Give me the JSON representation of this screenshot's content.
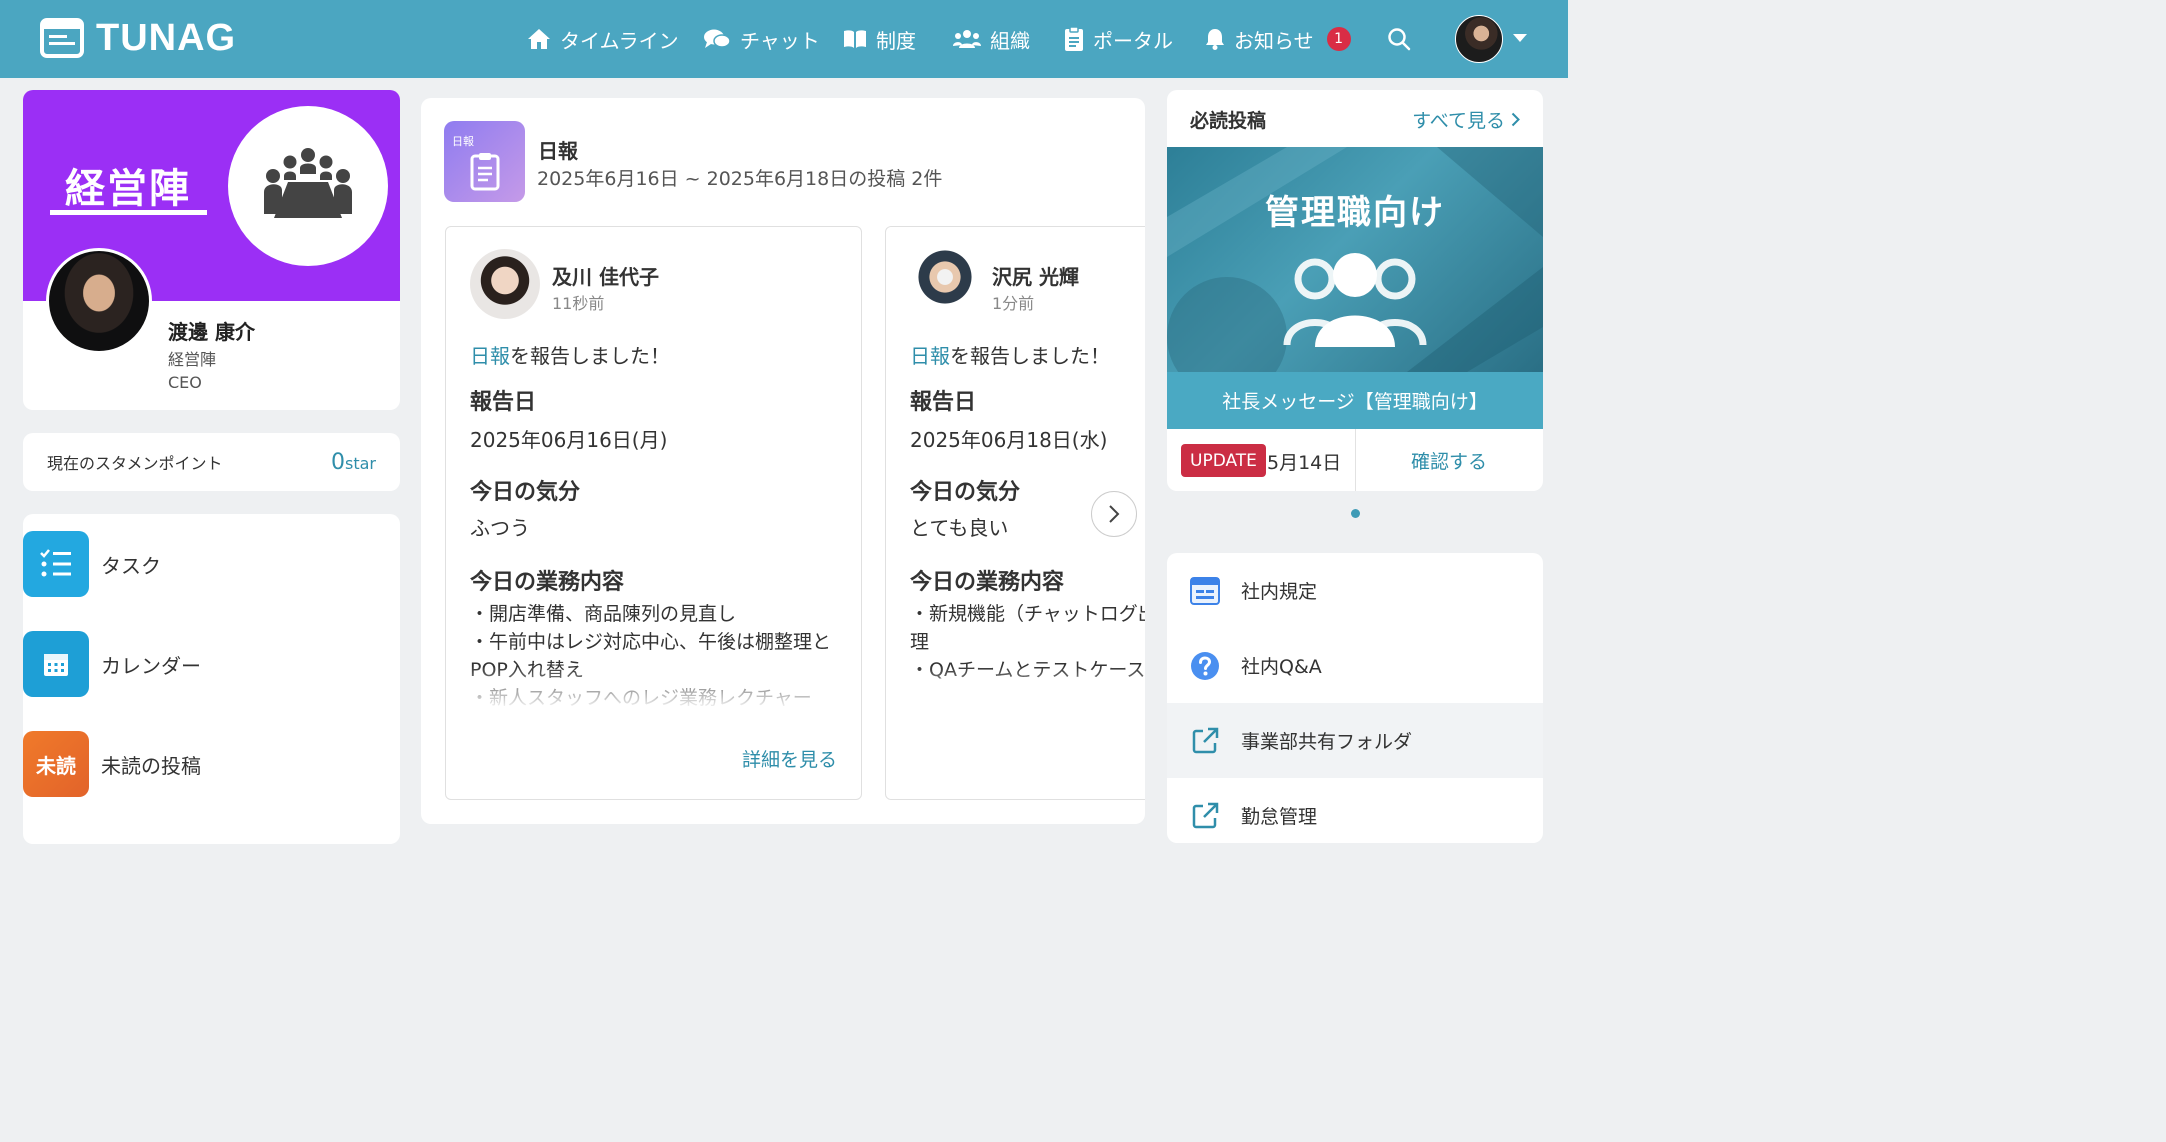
{
  "header": {
    "brand": "TUNAG",
    "nav": [
      {
        "icon": "home-icon",
        "label": "タイムライン"
      },
      {
        "icon": "chat-icon",
        "label": "チャット"
      },
      {
        "icon": "book-icon",
        "label": "制度"
      },
      {
        "icon": "people-icon",
        "label": "組織"
      },
      {
        "icon": "clipboard-icon",
        "label": "ポータル"
      },
      {
        "icon": "bell-icon",
        "label": "お知らせ"
      }
    ],
    "notification_count": "1",
    "colors": {
      "bar": "#4ba6c1",
      "badge": "#d92d45"
    }
  },
  "profile": {
    "team_name": "経営陣",
    "user_name": "渡邊 康介",
    "department": "経営陣",
    "role": "CEO",
    "banner_color": "#9b2ff5"
  },
  "stamen": {
    "label": "現在のスタメンポイント",
    "value": "0",
    "unit": "star"
  },
  "shortcuts": [
    {
      "label": "タスク",
      "icon": "task-list-icon"
    },
    {
      "label": "カレンダー",
      "icon": "calendar-icon"
    },
    {
      "label": "未読の投稿",
      "icon_text": "未読"
    }
  ],
  "nippo": {
    "title": "日報",
    "subtitle": "2025年6月16日 ~ 2025年6月18日の投稿 2件",
    "icon_text": "日報",
    "posts": [
      {
        "author": "及川 佳代子",
        "time": "11秒前",
        "link_word": "日報",
        "action": "を報告しました！",
        "h_date": "報告日",
        "date": "2025年06月16日(月)",
        "h_mood": "今日の気分",
        "mood": "ふつう",
        "h_work": "今日の業務内容",
        "work": "・開店準備、商品陳列の見直し\n・午前中はレジ対応中心、午後は棚整理とPOP入れ替え\n・新人スタッフへのレジ業務レクチャー",
        "detail_link": "詳細を見る"
      },
      {
        "author": "沢尻 光輝",
        "time": "1分前",
        "link_word": "日報",
        "action": "を報告しました！",
        "h_date": "報告日",
        "date": "2025年06月18日(水)",
        "h_mood": "今日の気分",
        "mood": "とても良い",
        "h_work": "今日の業務内容",
        "work": "・新規機能（チャットログ出力）の仕様整理\n・QAチームとテストケースのすり合わせ"
      }
    ]
  },
  "must_read": {
    "title": "必読投稿",
    "see_all": "すべて見る",
    "image_title": "管理職向け",
    "caption": "社長メッセージ【管理職向け】",
    "badge": "UPDATE",
    "date": "5月14日",
    "confirm": "確認する"
  },
  "links": [
    {
      "label": "社内規定",
      "icon": "document-icon"
    },
    {
      "label": "社内Q&A",
      "icon": "question-icon"
    },
    {
      "label": "事業部共有フォルダ",
      "icon": "external-link-icon"
    },
    {
      "label": "勤怠管理",
      "icon": "external-link-icon"
    }
  ]
}
